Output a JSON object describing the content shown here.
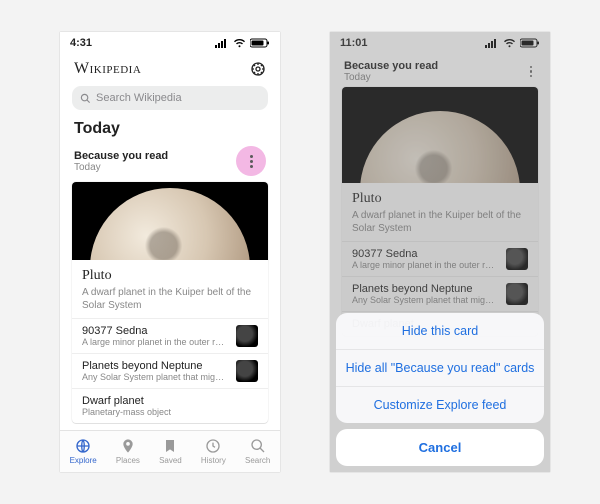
{
  "left": {
    "status_time": "4:31",
    "brand": "Wikipedia",
    "search_placeholder": "Search Wikipedia",
    "section": "Today",
    "card_heading": "Because you read",
    "card_subhead": "Today",
    "article": {
      "title": "Pluto",
      "subtitle": "A dwarf planet in the Kuiper belt of the Solar System"
    },
    "related": [
      {
        "title": "90377 Sedna",
        "sub": "A large minor planet in the outer rea…"
      },
      {
        "title": "Planets beyond Neptune",
        "sub": "Any Solar System planet that might…"
      },
      {
        "title": "Dwarf planet",
        "sub": "Planetary-mass object"
      }
    ],
    "tabs": [
      "Explore",
      "Places",
      "Saved",
      "History",
      "Search"
    ]
  },
  "right": {
    "status_time": "11:01",
    "card_heading": "Because you read",
    "card_subhead": "Today",
    "article": {
      "title": "Pluto",
      "subtitle": "A dwarf planet in the Kuiper belt of the Solar System"
    },
    "related": [
      {
        "title": "90377 Sedna",
        "sub": "A large minor planet in the outer rea…"
      },
      {
        "title": "Planets beyond Neptune",
        "sub": "Any Solar System planet that might…"
      },
      {
        "title": "Dwarf planet",
        "sub": ""
      }
    ],
    "sheet": {
      "items": [
        "Hide this card",
        "Hide all \"Because you read\" cards",
        "Customize Explore feed"
      ],
      "cancel": "Cancel"
    }
  }
}
